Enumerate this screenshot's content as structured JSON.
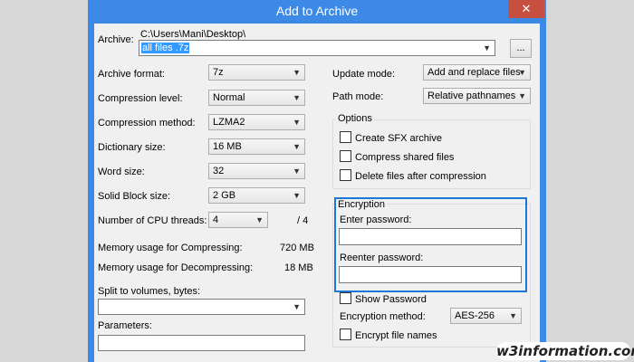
{
  "window": {
    "title": "Add to Archive",
    "close": "✕"
  },
  "archive": {
    "label": "Archive:",
    "path": "C:\\Users\\Mani\\Desktop\\",
    "name": "all files .7z",
    "browse": "..."
  },
  "left": {
    "format": {
      "label": "Archive format:",
      "value": "7z"
    },
    "level": {
      "label": "Compression level:",
      "value": "Normal"
    },
    "method": {
      "label": "Compression method:",
      "value": "LZMA2"
    },
    "dictionary": {
      "label": "Dictionary size:",
      "value": "16 MB"
    },
    "word": {
      "label": "Word size:",
      "value": "32"
    },
    "solid": {
      "label": "Solid Block size:",
      "value": "2 GB"
    },
    "threads": {
      "label": "Number of CPU threads:",
      "value": "4",
      "max": "/ 4"
    },
    "mem_comp": {
      "label": "Memory usage for Compressing:",
      "value": "720 MB"
    },
    "mem_decomp": {
      "label": "Memory usage for Decompressing:",
      "value": "18 MB"
    },
    "split": {
      "label": "Split to volumes, bytes:",
      "value": ""
    },
    "params": {
      "label": "Parameters:",
      "value": ""
    }
  },
  "right": {
    "update": {
      "label": "Update mode:",
      "value": "Add and replace files"
    },
    "path": {
      "label": "Path mode:",
      "value": "Relative pathnames"
    },
    "options": {
      "title": "Options",
      "sfx": "Create SFX archive",
      "shared": "Compress shared files",
      "delete": "Delete files after compression"
    },
    "encryption": {
      "title": "Encryption",
      "enter": "Enter password:",
      "reenter": "Reenter password:",
      "show": "Show Password",
      "method_label": "Encryption method:",
      "method_value": "AES-256",
      "encrypt_names": "Encrypt file names"
    }
  },
  "watermark": "w3information.com",
  "icons": {
    "dropdown": "chevron-down-icon",
    "close": "close-icon"
  },
  "colors": {
    "titlebar": "#3d8ae6",
    "close": "#c74f3f",
    "highlight": "#1c78d6",
    "selection": "#3399ff"
  }
}
